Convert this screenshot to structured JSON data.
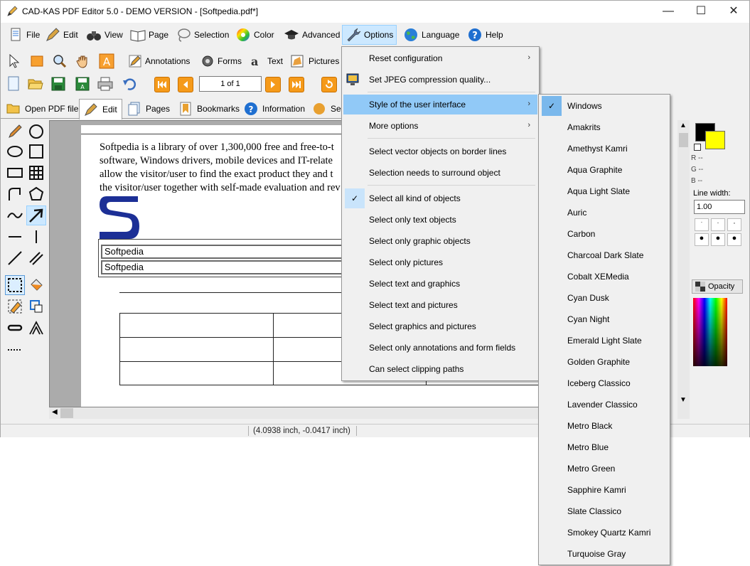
{
  "window": {
    "title": "CAD-KAS PDF Editor 5.0 - DEMO VERSION - [Softpedia.pdf*]",
    "min_glyph": "—",
    "max_glyph": "☐",
    "close_glyph": "✕"
  },
  "menubar": {
    "items": [
      {
        "label": "File",
        "icon": "file-icon"
      },
      {
        "label": "Edit",
        "icon": "edit-pen-icon"
      },
      {
        "label": "View",
        "icon": "binoculars-icon"
      },
      {
        "label": "Page",
        "icon": "book-icon"
      },
      {
        "label": "Selection",
        "icon": "lasso-icon"
      },
      {
        "label": "Color",
        "icon": "color-wheel-icon"
      },
      {
        "label": "Advanced",
        "icon": "graduation-cap-icon"
      },
      {
        "label": "Options",
        "icon": "wrench-icon"
      },
      {
        "label": "Language",
        "icon": "globe-icon"
      },
      {
        "label": "Help",
        "icon": "help-icon"
      }
    ]
  },
  "toolbar1": {
    "annotations": "Annotations",
    "forms": "Forms",
    "text": "Text",
    "pictures": "Pictures"
  },
  "toolbar2": {
    "page_indicator": "1 of 1"
  },
  "tabs": [
    {
      "label": "Open PDF file"
    },
    {
      "label": "Edit"
    },
    {
      "label": "Pages"
    },
    {
      "label": "Bookmarks"
    },
    {
      "label": "Information"
    },
    {
      "label": "Se"
    }
  ],
  "document": {
    "lines": [
      "Softpedia is a library of over 1,300,000 free and free-to-t",
      "software, Windows drivers, mobile devices and IT-relate",
      "allow the visitor/user to find the exact product they and t",
      "the visitor/user together with self-made evaluation and rev"
    ],
    "field1": "Softpedia",
    "field2": "Softpedia"
  },
  "right_panel": {
    "r_label": "R --",
    "g_label": "G --",
    "b_label": "B --",
    "line_width_label": "Line width:",
    "line_width_value": "1.00",
    "opacity_label": "Opacity"
  },
  "status": {
    "coords": "(4.0938 inch, -0.0417 inch)"
  },
  "options_menu": {
    "items": [
      {
        "label": "Reset configuration",
        "submenu": true
      },
      {
        "label": "Set JPEG compression quality...",
        "submenu": false
      },
      {
        "label": "Style of the user interface",
        "submenu": true,
        "highlighted": true
      },
      {
        "label": "More options",
        "submenu": true
      },
      {
        "label": "Select vector objects on border lines",
        "submenu": false
      },
      {
        "label": "Selection needs to surround object",
        "submenu": false
      },
      {
        "label": "Select all kind of objects",
        "submenu": false,
        "checked": true
      },
      {
        "label": "Select only text objects",
        "submenu": false
      },
      {
        "label": "Select only graphic objects",
        "submenu": false
      },
      {
        "label": "Select only pictures",
        "submenu": false
      },
      {
        "label": "Select text and graphics",
        "submenu": false
      },
      {
        "label": "Select text and pictures",
        "submenu": false
      },
      {
        "label": "Select graphics and pictures",
        "submenu": false
      },
      {
        "label": "Select only annotations and form fields",
        "submenu": false
      },
      {
        "label": "Can select clipping paths",
        "submenu": false
      }
    ]
  },
  "style_submenu": {
    "items": [
      {
        "label": "Windows",
        "checked": true
      },
      {
        "label": "Amakrits"
      },
      {
        "label": "Amethyst Kamri"
      },
      {
        "label": "Aqua Graphite"
      },
      {
        "label": "Aqua Light Slate"
      },
      {
        "label": "Auric"
      },
      {
        "label": "Carbon"
      },
      {
        "label": "Charcoal Dark Slate"
      },
      {
        "label": "Cobalt XEMedia"
      },
      {
        "label": "Cyan Dusk"
      },
      {
        "label": "Cyan Night"
      },
      {
        "label": "Emerald Light Slate"
      },
      {
        "label": "Golden Graphite"
      },
      {
        "label": "Iceberg Classico"
      },
      {
        "label": "Lavender Classico"
      },
      {
        "label": "Metro Black"
      },
      {
        "label": "Metro Blue"
      },
      {
        "label": "Metro Green"
      },
      {
        "label": "Sapphire Kamri"
      },
      {
        "label": "Slate Classico"
      },
      {
        "label": "Smokey Quartz Kamri"
      },
      {
        "label": "Turquoise Gray"
      }
    ]
  },
  "colors": {
    "highlight": "#91c9f7",
    "check_bg": "#c9e4fb",
    "nav_orange": "#f59a1a",
    "primary_color": "#000000",
    "secondary_color": "#ffff00"
  }
}
